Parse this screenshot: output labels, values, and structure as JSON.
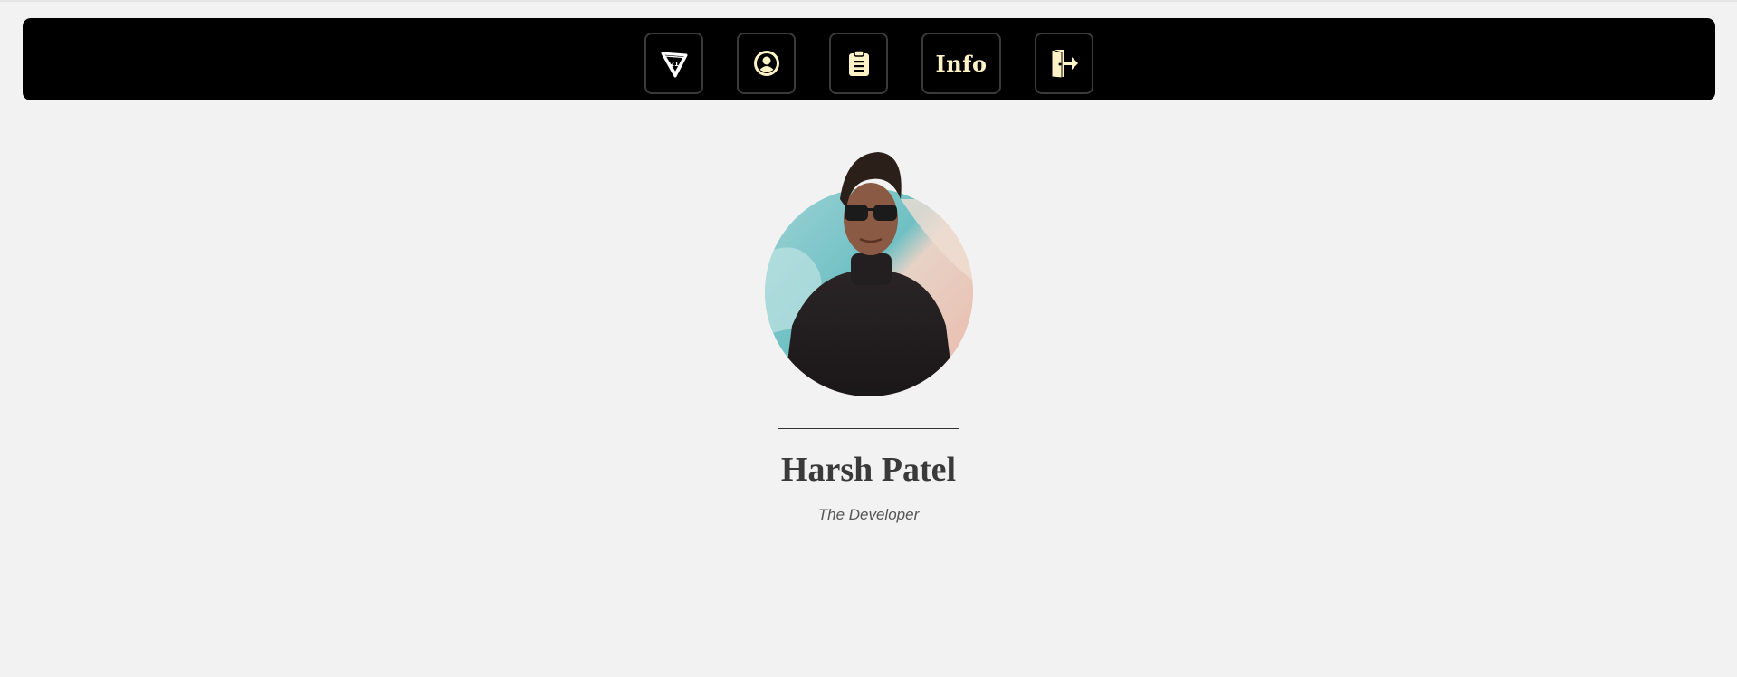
{
  "nav": {
    "items": [
      {
        "icon": "brand-logo-icon"
      },
      {
        "icon": "user-circle-icon"
      },
      {
        "icon": "clipboard-icon"
      },
      {
        "label": "Info"
      },
      {
        "icon": "logout-door-icon"
      }
    ]
  },
  "colors": {
    "background": "#f2f2f2",
    "navbar": "#000000",
    "icon_accent": "#fff2c6",
    "name_text": "#3a3a3a"
  },
  "profile": {
    "name": "Harsh Patel",
    "tagline": "The Developer"
  }
}
